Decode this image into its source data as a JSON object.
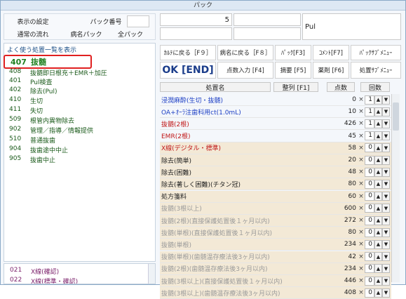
{
  "window": {
    "title": "パック"
  },
  "top_left": {
    "display_settings": "表示の設定",
    "pack_number_label": "パック番号",
    "normal_flow": "通常の流れ",
    "disease_pack": "病名パック",
    "all_pack": "全パック"
  },
  "top_mid": {
    "value": "5",
    "name": "Pul"
  },
  "toolbar": {
    "r1": [
      "ｶﾙﾃに戻る［F９］",
      "病名に戻る［F８］",
      "ﾊﾟｯｸ[F3]",
      "ｺﾒﾝﾄ[F7]",
      "ﾊﾟｯｸｻﾌﾞﾒﾆｭｰ"
    ],
    "ok": "OK [END]",
    "r2": [
      "点数入力 [F4]",
      "摘要 [F5]",
      "薬剤 [F6]",
      "処置ｻﾌﾞﾒﾆｭｰ"
    ]
  },
  "left_panel": {
    "title": "よく使う処置一覧を表示",
    "selected": {
      "code": "407",
      "label": "抜髄"
    },
    "items": [
      {
        "code": "408",
        "label": "抜髄即日根充＋EMR＋加圧"
      },
      {
        "code": "401",
        "label": "Pul検査"
      },
      {
        "code": "402",
        "label": "除去(Pul)"
      },
      {
        "code": "410",
        "label": "生切"
      },
      {
        "code": "411",
        "label": "失切"
      },
      {
        "code": "509",
        "label": "根管内異物除去"
      },
      {
        "code": "902",
        "label": "管理／指導／情報提供"
      },
      {
        "code": "510",
        "label": "普通抜歯"
      },
      {
        "code": "904",
        "label": "抜歯途中中止"
      },
      {
        "code": "905",
        "label": "抜歯中止"
      }
    ]
  },
  "bottom_panel": {
    "items": [
      {
        "code": "021",
        "label": "X線(確認)"
      },
      {
        "code": "022",
        "label": "X線(標準・確認)"
      }
    ]
  },
  "table": {
    "headers": {
      "name": "処置名",
      "sort": "整列 [F1]",
      "points": "点数",
      "count": "回数"
    },
    "rows": [
      {
        "name": "浸潤麻酔(生切・抜髄)",
        "points": "0",
        "count": "1",
        "style": "blue"
      },
      {
        "name": "OA+ｵｰﾗ注歯科用ct(1.0mL)",
        "points": "10",
        "count": "1",
        "style": "blue"
      },
      {
        "name": "抜髄(2根)",
        "points": "426",
        "count": "1",
        "style": "red"
      },
      {
        "name": "EMR(2根)",
        "points": "45",
        "count": "1",
        "style": "red"
      },
      {
        "name": "X線(デジタル・標準)",
        "points": "58",
        "count": "0",
        "style": "red",
        "shade": true
      },
      {
        "name": "除去(簡単)",
        "points": "20",
        "count": "0",
        "style": "black",
        "shade": true
      },
      {
        "name": "除去(困難)",
        "points": "48",
        "count": "0",
        "style": "black",
        "shade": true
      },
      {
        "name": "除去(著しく困難)(チタン冠)",
        "points": "80",
        "count": "0",
        "style": "black",
        "shade": true
      },
      {
        "name": "処方箋料",
        "points": "60",
        "count": "0",
        "style": "black",
        "shade": true
      },
      {
        "name": "抜髄(3根以上)",
        "points": "600",
        "count": "0",
        "style": "gray",
        "shade": true
      },
      {
        "name": "抜髄(2根)(直接保護処置後１ヶ月以内)",
        "points": "272",
        "count": "0",
        "style": "gray",
        "shade": true
      },
      {
        "name": "抜髄(単根)(直接保護処置後１ヶ月以内)",
        "points": "80",
        "count": "0",
        "style": "gray",
        "shade": true
      },
      {
        "name": "抜髄(単根)",
        "points": "234",
        "count": "0",
        "style": "gray",
        "shade": true
      },
      {
        "name": "抜髄(単根)(歯髄温存療法後3ヶ月以内)",
        "points": "42",
        "count": "0",
        "style": "gray",
        "shade": true
      },
      {
        "name": "抜髄(2根)(歯髄温存療法後3ヶ月以内)",
        "points": "234",
        "count": "0",
        "style": "gray",
        "shade": true
      },
      {
        "name": "抜髄(3根以上)(直接保護処置後１ヶ月以内)",
        "points": "446",
        "count": "0",
        "style": "gray",
        "shade": true
      },
      {
        "name": "抜髄(3根以上)(歯髄温存療法後3ヶ月以内)",
        "points": "408",
        "count": "0",
        "style": "gray",
        "shade": true
      }
    ]
  }
}
